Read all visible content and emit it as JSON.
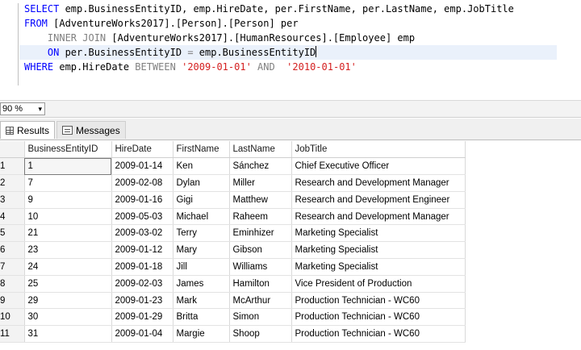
{
  "editor": {
    "lines": [
      {
        "segments": [
          {
            "t": "SELECT",
            "c": "kw"
          },
          {
            "t": " emp.BusinessEntityID, emp.HireDate, per.FirstName, per.LastName, emp.JobTitle",
            "c": ""
          }
        ]
      },
      {
        "segments": [
          {
            "t": "FROM",
            "c": "kw"
          },
          {
            "t": " [AdventureWorks2017].[Person].[Person] per",
            "c": ""
          }
        ]
      },
      {
        "segments": [
          {
            "t": "    ",
            "c": ""
          },
          {
            "t": "INNER JOIN",
            "c": "gr"
          },
          {
            "t": " [AdventureWorks2017].[HumanResources].[Employee] emp",
            "c": ""
          }
        ]
      },
      {
        "segments": [
          {
            "t": "    ",
            "c": ""
          },
          {
            "t": "ON",
            "c": "kw"
          },
          {
            "t": " per.BusinessEntityID ",
            "c": ""
          },
          {
            "t": "=",
            "c": "gr"
          },
          {
            "t": " emp.BusinessEntityID",
            "c": ""
          }
        ],
        "current": true
      },
      {
        "segments": [
          {
            "t": "WHERE",
            "c": "kw"
          },
          {
            "t": " emp.HireDate ",
            "c": ""
          },
          {
            "t": "BETWEEN",
            "c": "gr"
          },
          {
            "t": " ",
            "c": ""
          },
          {
            "t": "'2009-01-01'",
            "c": "str"
          },
          {
            "t": " ",
            "c": ""
          },
          {
            "t": "AND",
            "c": "gr"
          },
          {
            "t": "  ",
            "c": ""
          },
          {
            "t": "'2010-01-01'",
            "c": "str"
          }
        ]
      }
    ]
  },
  "zoom": {
    "value": "90 %",
    "icon": "chevron-down-icon"
  },
  "tabs": {
    "results_label": "Results",
    "messages_label": "Messages",
    "results_icon": "grid-icon",
    "messages_icon": "message-icon"
  },
  "grid": {
    "columns": [
      "BusinessEntityID",
      "HireDate",
      "FirstName",
      "LastName",
      "JobTitle"
    ],
    "rows": [
      {
        "n": "1",
        "id": "1",
        "hire": "2009-01-14",
        "first": "Ken",
        "last": "Sánchez",
        "title": "Chief Executive Officer"
      },
      {
        "n": "2",
        "id": "7",
        "hire": "2009-02-08",
        "first": "Dylan",
        "last": "Miller",
        "title": "Research and Development Manager"
      },
      {
        "n": "3",
        "id": "9",
        "hire": "2009-01-16",
        "first": "Gigi",
        "last": "Matthew",
        "title": "Research and Development Engineer"
      },
      {
        "n": "4",
        "id": "10",
        "hire": "2009-05-03",
        "first": "Michael",
        "last": "Raheem",
        "title": "Research and Development Manager"
      },
      {
        "n": "5",
        "id": "21",
        "hire": "2009-03-02",
        "first": "Terry",
        "last": "Eminhizer",
        "title": "Marketing Specialist"
      },
      {
        "n": "6",
        "id": "23",
        "hire": "2009-01-12",
        "first": "Mary",
        "last": "Gibson",
        "title": "Marketing Specialist"
      },
      {
        "n": "7",
        "id": "24",
        "hire": "2009-01-18",
        "first": "Jill",
        "last": "Williams",
        "title": "Marketing Specialist"
      },
      {
        "n": "8",
        "id": "25",
        "hire": "2009-02-03",
        "first": "James",
        "last": "Hamilton",
        "title": "Vice President of Production"
      },
      {
        "n": "9",
        "id": "29",
        "hire": "2009-01-23",
        "first": "Mark",
        "last": "McArthur",
        "title": "Production Technician - WC60"
      },
      {
        "n": "10",
        "id": "30",
        "hire": "2009-01-29",
        "first": "Britta",
        "last": "Simon",
        "title": "Production Technician - WC60"
      },
      {
        "n": "11",
        "id": "31",
        "hire": "2009-01-04",
        "first": "Margie",
        "last": "Shoop",
        "title": "Production Technician - WC60"
      }
    ]
  }
}
